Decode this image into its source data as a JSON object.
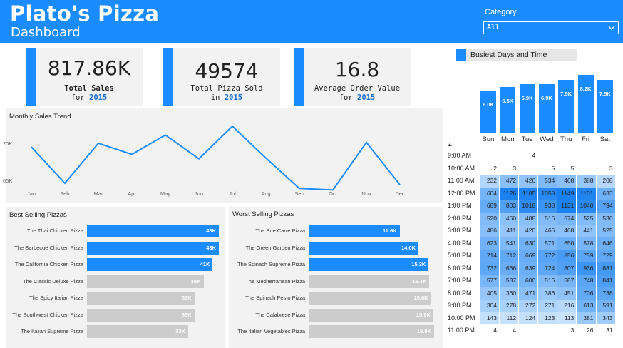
{
  "header": {
    "title": "Plato's Pizza",
    "subtitle": "Dashboard",
    "category_label": "Category",
    "category_value": "All",
    "bg_color": "#1a8cff"
  },
  "kpis": [
    {
      "value": "817.86K",
      "label_line1": "Total Sales",
      "label_line2_prefix": "for",
      "year": "2015"
    },
    {
      "value": "49574",
      "label_line1": "Total Pizza Sold",
      "label_line2_prefix": "in",
      "year": "2015"
    },
    {
      "value": "16.8",
      "label_line1": "Average Order Value",
      "label_line2_prefix": "for",
      "year": "2015"
    }
  ],
  "monthly": {
    "title": "Monthly Sales Trend",
    "y_ticks": [
      "70K",
      "65K"
    ]
  },
  "best": {
    "title": "Best Selling Pizzas"
  },
  "worst": {
    "title": "Worst Selling Pizzas"
  },
  "busiest": {
    "title": "Busiest Days and Time"
  },
  "chart_data": [
    {
      "type": "line",
      "title": "Monthly Sales Trend",
      "categories": [
        "Jan",
        "Feb",
        "Mar",
        "Apr",
        "May",
        "Jun",
        "Jul",
        "Aug",
        "Sep",
        "Oct",
        "Nov",
        "Dec"
      ],
      "values": [
        69800,
        64900,
        70300,
        68800,
        71400,
        68200,
        72600,
        68300,
        64200,
        64000,
        70400,
        64700
      ],
      "ylabel": "",
      "xlabel": "",
      "y_ticks": [
        "70K",
        "65K"
      ],
      "color": "#1a8cff"
    },
    {
      "type": "bar",
      "orientation": "horizontal",
      "title": "Best Selling Pizzas",
      "categories": [
        "The Thai Chicken Pizza",
        "The Barbecue Chicken Pizza",
        "The California Chicken Pizza",
        "The Classic Deluxe Pizza",
        "The Spicy Italian Pizza",
        "The Southwest Chicken Pizza",
        "The Italian Supreme Pizza"
      ],
      "values": [
        43,
        43,
        41,
        38,
        35,
        35,
        33
      ],
      "labels": [
        "43K",
        "43K",
        "41K",
        "38K",
        "35K",
        "35K",
        "33K"
      ],
      "highlight": [
        true,
        true,
        true,
        false,
        false,
        false,
        false
      ],
      "colors": {
        "highlight": "#1a8cff",
        "normal": "#cccccc"
      }
    },
    {
      "type": "bar",
      "orientation": "horizontal",
      "title": "Worst Selling Pizzas",
      "categories": [
        "The Brie Carre Pizza",
        "The Green Garden Pizza",
        "The Spinach Supreme Pizza",
        "The Mediterranean Pizza",
        "The Spinach Pesto Pizza",
        "The Calabrese Pizza",
        "The Italian Vegetables Pizza"
      ],
      "values": [
        11.6,
        14.0,
        15.3,
        15.4,
        15.6,
        15.9,
        16.0
      ],
      "labels": [
        "11.6K",
        "14.0K",
        "15.3K",
        "15.4K",
        "15.6K",
        "15.9K",
        "16.0K"
      ],
      "highlight": [
        true,
        true,
        true,
        false,
        false,
        false,
        false
      ],
      "colors": {
        "highlight": "#1a8cff",
        "normal": "#cccccc"
      }
    },
    {
      "type": "bar",
      "title": "Busiest Days and Time",
      "categories": [
        "Sun",
        "Mon",
        "Tue",
        "Wed",
        "Thu",
        "Fri",
        "Sat"
      ],
      "values": [
        6.0,
        6.5,
        6.9,
        6.9,
        7.5,
        8.2,
        7.5
      ],
      "labels": [
        "6.0K",
        "6.5K",
        "6.9K",
        "6.9K",
        "7.5K",
        "8.2K",
        "7.5K"
      ],
      "color": "#1a8cff"
    },
    {
      "type": "heatmap",
      "columns": [
        "Sun",
        "Mon",
        "Tue",
        "Wed",
        "Thu",
        "Fri",
        "Sat"
      ],
      "rows": [
        "9:00 AM",
        "10:00 AM",
        "11:00 AM",
        "12:00 PM",
        "1:00 PM",
        "2:00 PM",
        "3:00 PM",
        "4:00 PM",
        "5:00 PM",
        "6:00 PM",
        "7:00 PM",
        "8:00 PM",
        "9:00 PM",
        "10:00 PM",
        "11:00 PM"
      ],
      "values": [
        [
          null,
          null,
          4,
          null,
          null,
          null,
          null
        ],
        [
          2,
          3,
          null,
          5,
          5,
          null,
          3
        ],
        [
          232,
          472,
          426,
          534,
          468,
          388,
          208
        ],
        [
          604,
          1126,
          1105,
          1058,
          1149,
          1101,
          633
        ],
        [
          689,
          803,
          1018,
          938,
          1131,
          1040,
          794
        ],
        [
          520,
          460,
          488,
          516,
          574,
          525,
          530
        ],
        [
          486,
          411,
          420,
          465,
          468,
          441,
          525
        ],
        [
          623,
          541,
          630,
          571,
          650,
          578,
          646
        ],
        [
          714,
          712,
          669,
          772,
          856,
          759,
          729
        ],
        [
          732,
          666,
          639,
          724,
          807,
          936,
          881
        ],
        [
          577,
          537,
          600,
          516,
          587,
          748,
          841
        ],
        [
          405,
          360,
          471,
          386,
          451,
          706,
          738
        ],
        [
          304,
          278,
          272,
          271,
          216,
          613,
          591
        ],
        [
          143,
          112,
          124,
          123,
          113,
          381,
          343
        ],
        [
          4,
          4,
          null,
          null,
          3,
          26,
          31
        ]
      ]
    }
  ]
}
